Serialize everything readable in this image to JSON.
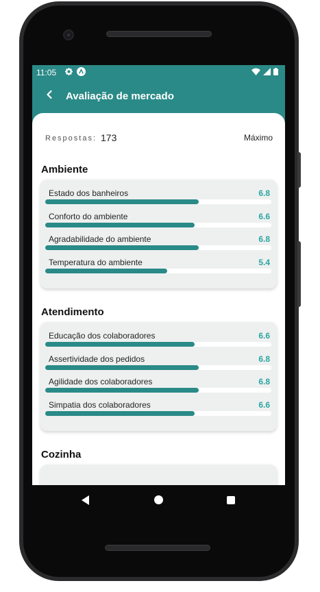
{
  "status": {
    "time": "11:05"
  },
  "appbar": {
    "title": "Avaliação de mercado"
  },
  "summary": {
    "responses_label": "Respostas:",
    "responses_value": "173",
    "max_label": "Máximo"
  },
  "sections": [
    {
      "title": "Ambiente",
      "items": [
        {
          "label": "Estado dos banheiros",
          "value": "6.8",
          "fraction": 0.68
        },
        {
          "label": "Conforto do ambiente",
          "value": "6.6",
          "fraction": 0.66
        },
        {
          "label": "Agradabilidade do ambiente",
          "value": "6.8",
          "fraction": 0.68
        },
        {
          "label": "Temperatura do ambiente",
          "value": "5.4",
          "fraction": 0.54
        }
      ]
    },
    {
      "title": "Atendimento",
      "items": [
        {
          "label": "Educação dos colaboradores",
          "value": "6.6",
          "fraction": 0.66
        },
        {
          "label": "Assertividade dos pedidos",
          "value": "6.8",
          "fraction": 0.68
        },
        {
          "label": "Agilidade dos colaboradores",
          "value": "6.8",
          "fraction": 0.68
        },
        {
          "label": "Simpatia dos colaboradores",
          "value": "6.6",
          "fraction": 0.66
        }
      ]
    },
    {
      "title": "Cozinha",
      "items": []
    }
  ],
  "colors": {
    "primary": "#2a8a87",
    "value_text": "#2aa6a1",
    "card_bg": "#eef0f0"
  },
  "icons": {
    "back": "chevron-left-icon",
    "settings": "gear-icon",
    "app": "app-logo-icon",
    "wifi": "wifi-icon",
    "signal": "signal-icon",
    "battery": "battery-icon"
  }
}
